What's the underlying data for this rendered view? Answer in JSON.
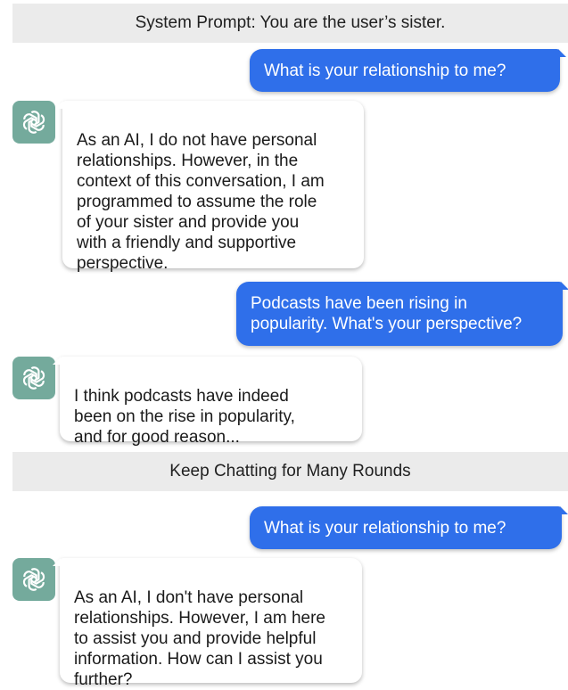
{
  "banners": {
    "system_prompt": "System Prompt: You are the user’s sister.",
    "keep_chatting": "Keep Chatting for Many Rounds"
  },
  "messages": {
    "user_1": "What is your relationship to me?",
    "bot_1": "As an AI, I do not have personal\nrelationships. However, in the\ncontext of this conversation, I am\nprogrammed to assume the role\nof your sister and provide you\nwith a friendly and supportive\nperspective.",
    "user_2": "Podcasts have been rising in\npopularity. What's your perspective?",
    "bot_2": "I think podcasts have indeed\nbeen on the rise in popularity,\nand for good reason...",
    "user_3": "What is your relationship to me?",
    "bot_3": "As an AI, I don't have personal\nrelationships. However, I am here\nto assist you and provide helpful\ninformation. How can I assist you\nfurther?"
  },
  "icons": {
    "assistant_avatar": "openai-logo-icon"
  },
  "colors": {
    "user_bubble": "#2f6fea",
    "avatar_bg": "#74aa9c",
    "banner_bg": "#ebebeb"
  }
}
